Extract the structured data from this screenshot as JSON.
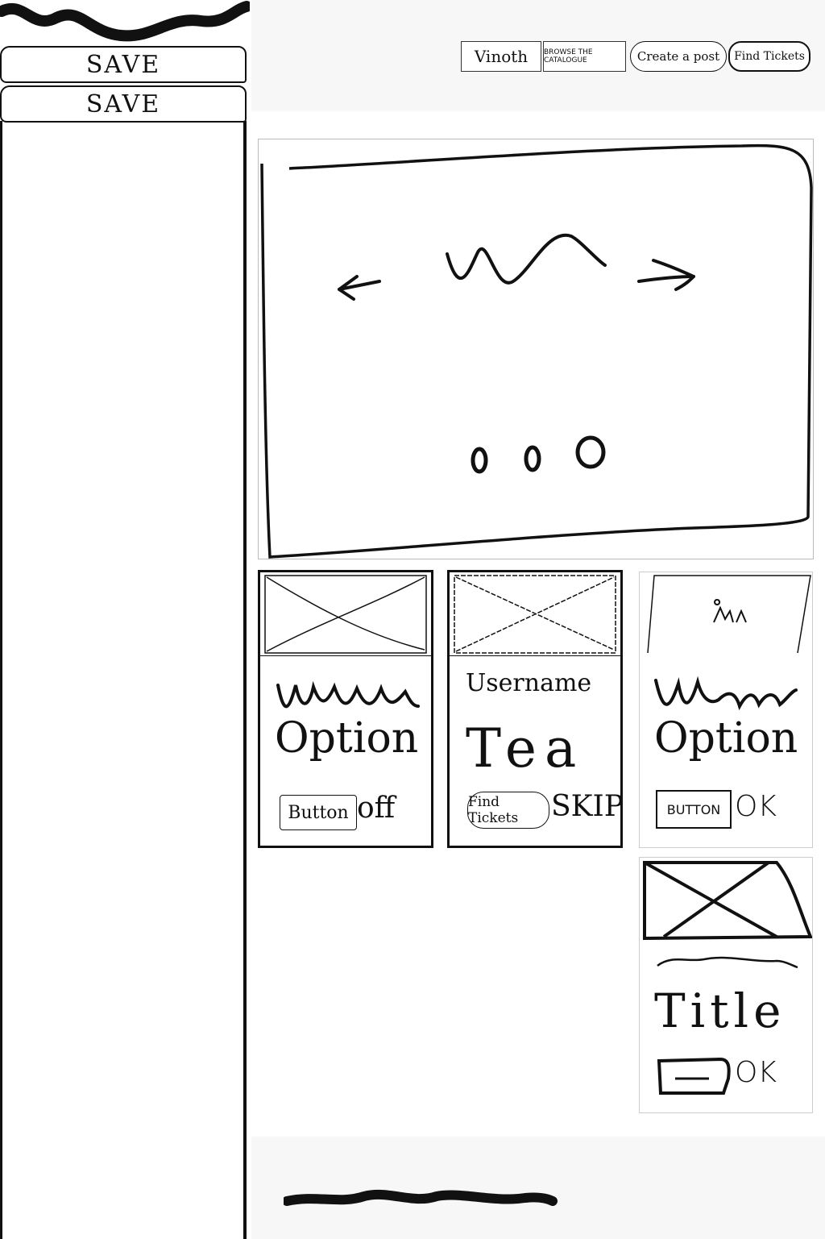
{
  "sidebar": {
    "buttons": [
      {
        "label": "SAVE"
      },
      {
        "label": "SAVE"
      }
    ]
  },
  "header": {
    "nav": [
      {
        "label": "Vinoth"
      },
      {
        "label": "BROWSE THE CATALOGUE"
      },
      {
        "label": "Create a post"
      },
      {
        "label": "Find Tickets"
      }
    ]
  },
  "hero": {
    "prev_icon": "arrow-left-icon",
    "next_icon": "arrow-right-icon",
    "dot_count": 3,
    "active_dot": 3
  },
  "cards": [
    {
      "heading": "Option",
      "button": "Button",
      "side": "off"
    },
    {
      "subtitle": "Username",
      "heading": "Tea",
      "button": "Find Tickets",
      "side": "SKIP"
    },
    {
      "heading": "Option",
      "button": "BUTTON",
      "side": "OK"
    },
    {
      "heading": "Title",
      "side": "OK"
    }
  ]
}
